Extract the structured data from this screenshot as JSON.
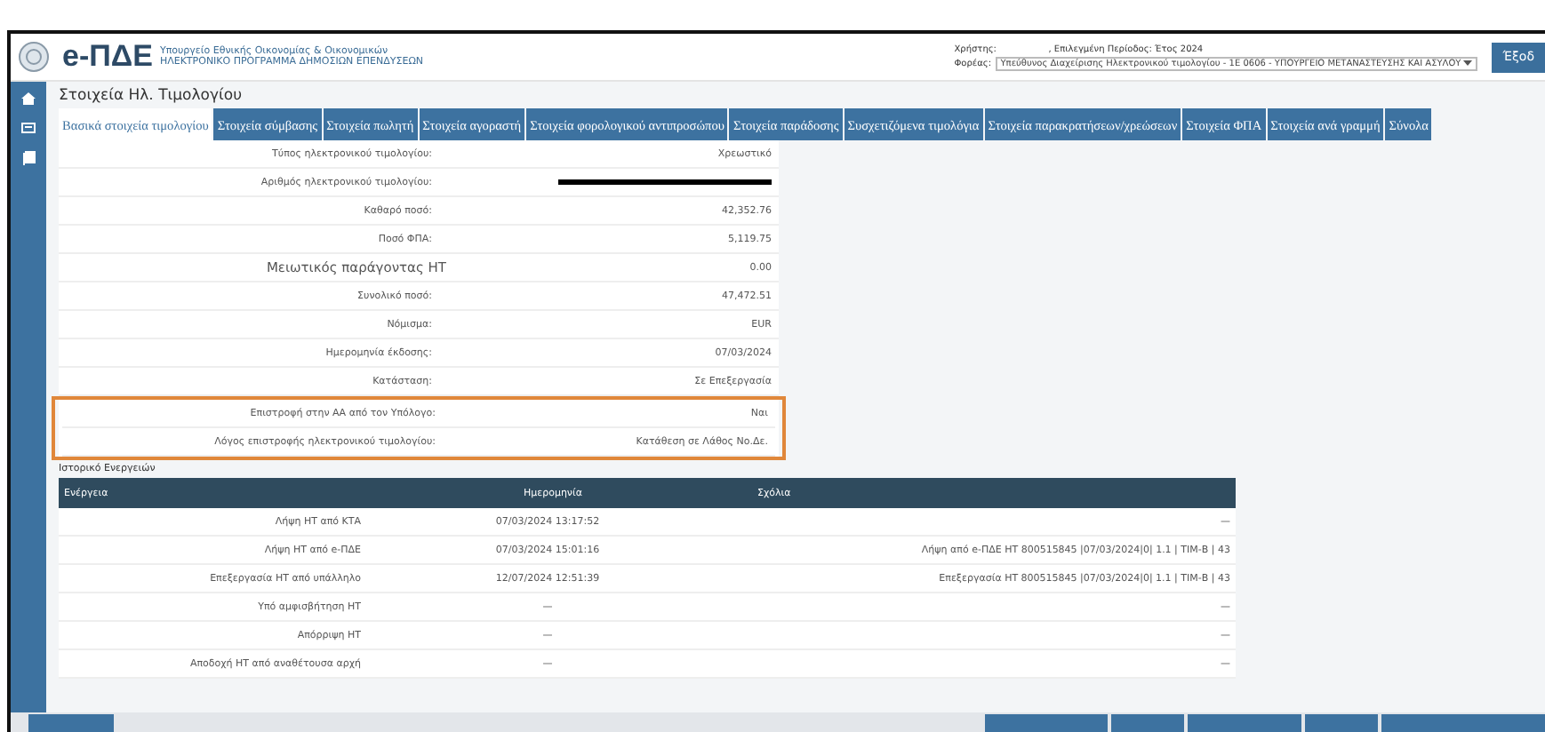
{
  "header": {
    "brand": "e-ΠΔΕ",
    "ministry": "Υπουργείο Εθνικής Οικονομίας & Οικονομικών",
    "program": "ΗΛΕΚΤΡΟΝΙΚΟ ΠΡΟΓΡΑΜΜΑ ΔΗΜΟΣΙΩΝ ΕΠΕΝΔΥΣΕΩΝ",
    "user_label": "Χρήστης:",
    "period": ", Επιλεγμένη Περίοδος: Έτος 2024",
    "entity_label": "Φορέας:",
    "entity_value": "Υπεύθυνος Διαχείρισης Ηλεκτρονικού τιμολογίου - 1Ε 0606 - ΥΠΟΥΡΓΕΙΟ ΜΕΤΑΝΑΣΤΕΥΣΗΣ ΚΑΙ ΑΣΥΛΟΥ",
    "exit_button": "Έξοδ"
  },
  "page_title": "Στοιχεία Ηλ. Τιμολογίου",
  "tabs": [
    {
      "label": "Βασικά στοιχεία τιμολογίου",
      "selected": true
    },
    {
      "label": "Στοιχεία σύμβασης",
      "selected": false
    },
    {
      "label": "Στοιχεία πωλητή",
      "selected": false
    },
    {
      "label": "Στοιχεία αγοραστή",
      "selected": false
    },
    {
      "label": "Στοιχεία φορολογικού αντιπροσώπου",
      "selected": false
    },
    {
      "label": "Στοιχεία παράδοσης",
      "selected": false
    },
    {
      "label": "Συσχετιζόμενα τιμολόγια",
      "selected": false
    },
    {
      "label": "Στοιχεία παρακρατήσεων/χρεώσεων",
      "selected": false
    },
    {
      "label": "Στοιχεία ΦΠΑ",
      "selected": false
    },
    {
      "label": "Στοιχεία ανά γραμμή",
      "selected": false
    },
    {
      "label": "Σύνολα",
      "selected": false
    }
  ],
  "details": {
    "rows": [
      {
        "kind": "text",
        "label": "Τύπος ηλεκτρονικού τιμολογίου:",
        "value": "Χρεωστικό"
      },
      {
        "kind": "redacted",
        "label": "Αριθμός ηλεκτρονικού τιμολογίου:"
      },
      {
        "kind": "text",
        "label": "Καθαρό ποσό:",
        "value": "42,352.76"
      },
      {
        "kind": "text",
        "label": "Ποσό ΦΠΑ:",
        "value": "5,119.75"
      },
      {
        "kind": "large",
        "label": "Μειωτικός παράγοντας ΗΤ",
        "value": "0.00"
      },
      {
        "kind": "text",
        "label": "Συνολικό ποσό:",
        "value": "47,472.51"
      },
      {
        "kind": "text",
        "label": "Νόμισμα:",
        "value": "EUR"
      },
      {
        "kind": "text",
        "label": "Ημερομηνία έκδοσης:",
        "value": "07/03/2024"
      },
      {
        "kind": "text",
        "label": "Κατάσταση:",
        "value": "Σε Επεξεργασία"
      }
    ],
    "highlighted_rows": [
      {
        "label": "Επιστροφή στην ΑΑ από τον Υπόλογο:",
        "value": "Ναι"
      },
      {
        "label": "Λόγος επιστροφής ηλεκτρονικού τιμολογίου:",
        "value": "Κατάθεση σε Λάθος Νο.Δε."
      }
    ]
  },
  "history": {
    "title": "Ιστορικό Ενεργειών",
    "columns": [
      "Ενέργεια",
      "Ημερομηνία",
      "Σχόλια"
    ],
    "rows": [
      [
        "Λήψη ΗΤ από ΚΤΑ",
        "07/03/2024 13:17:52",
        "—"
      ],
      [
        "Λήψη ΗΤ από e-ΠΔΕ",
        "07/03/2024 15:01:16",
        "Λήψη από e-ΠΔΕ ΗΤ 800515845 |07/03/2024|0| 1.1 | ΤΙΜ-Β | 43"
      ],
      [
        "Επεξεργασία ΗΤ από υπάλληλο",
        "12/07/2024 12:51:39",
        "Επεξεργασία ΗΤ 800515845 |07/03/2024|0| 1.1 | ΤΙΜ-Β | 43"
      ],
      [
        "Υπό αμφισβήτηση ΗΤ",
        "—",
        "—"
      ],
      [
        "Απόρριψη ΗΤ",
        "—",
        "—"
      ],
      [
        "Αποδοχή ΗΤ από αναθέτουσα αρχή",
        "—",
        "—"
      ]
    ]
  }
}
